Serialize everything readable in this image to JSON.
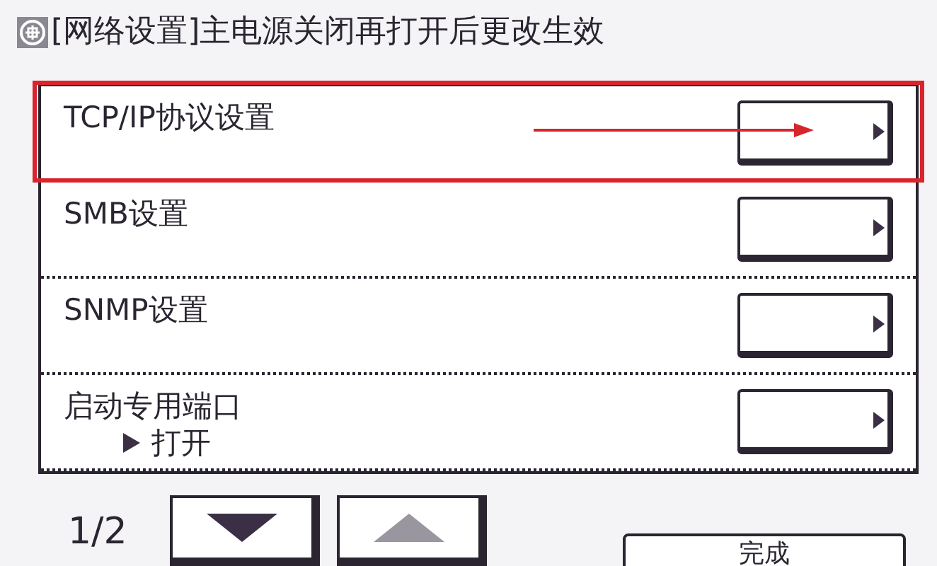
{
  "title": "[网络设置]主电源关闭再打开后更改生效",
  "rows": [
    {
      "label": "TCP/IP协议设置",
      "highlighted": true
    },
    {
      "label": "SMB设置",
      "highlighted": false
    },
    {
      "label": "SNMP设置",
      "highlighted": false
    },
    {
      "label": "启动专用端口",
      "value": "打开",
      "highlighted": false
    }
  ],
  "pager": {
    "page": "1/2",
    "down_disabled": false,
    "up_disabled": true
  },
  "done_button": "完成"
}
